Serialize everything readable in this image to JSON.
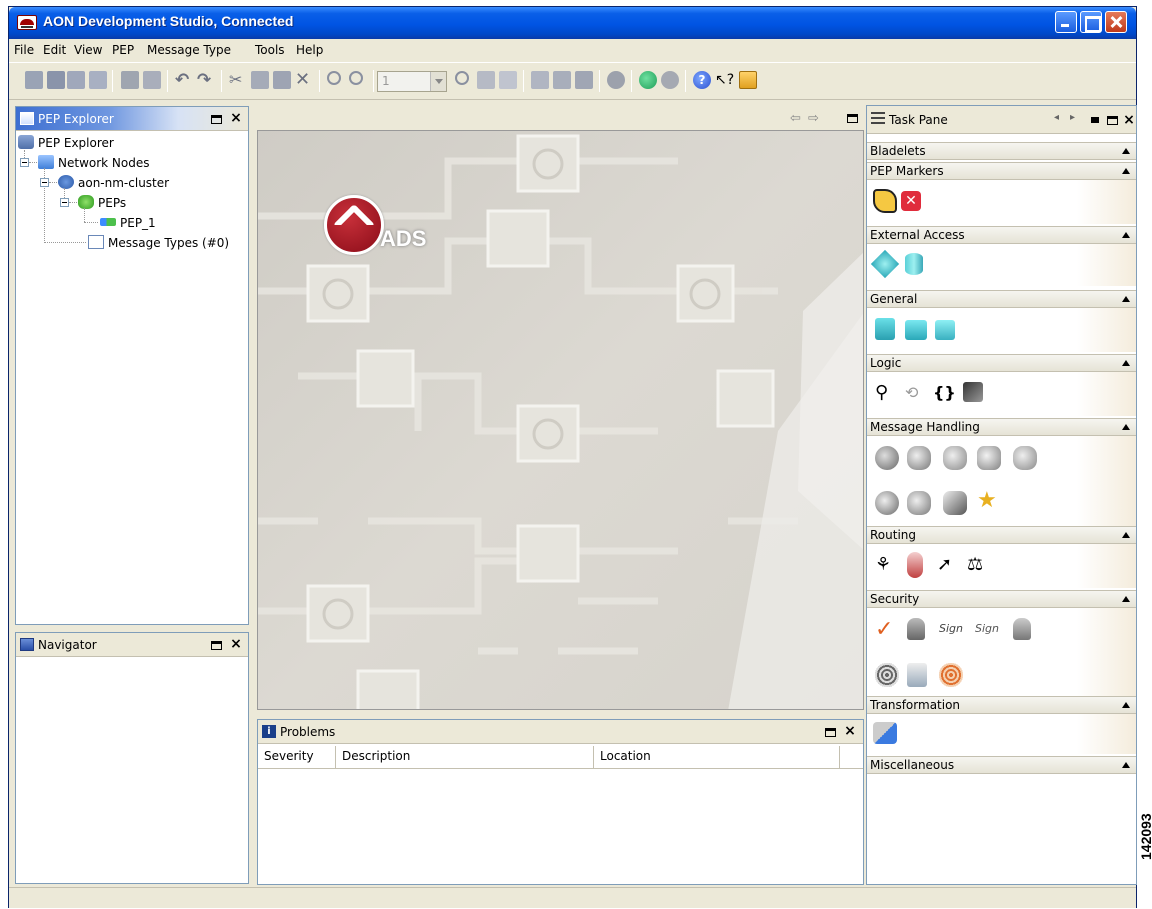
{
  "window": {
    "title": "AON Development Studio, Connected"
  },
  "menu": [
    "File",
    "Edit",
    "View",
    "PEP",
    "Message Type",
    "Tools",
    "Help"
  ],
  "toolbar": {
    "zoom_value": "1"
  },
  "pep_explorer": {
    "title": "PEP Explorer",
    "tree": {
      "root": "PEP Explorer",
      "network_nodes": "Network Nodes",
      "cluster": "aon-nm-cluster",
      "peps": "PEPs",
      "pep1": "PEP_1",
      "message_types": "Message Types (#0)"
    }
  },
  "navigator": {
    "title": "Navigator"
  },
  "editor": {
    "logo_text": "ADS"
  },
  "task_pane": {
    "title": "Task Pane",
    "bladelets": "Bladelets",
    "sections": {
      "pep_markers": "PEP Markers",
      "external_access": "External Access",
      "general": "General",
      "logic": "Logic",
      "message_handling": "Message Handling",
      "routing": "Routing",
      "security": "Security",
      "transformation": "Transformation",
      "miscellaneous": "Miscellaneous"
    }
  },
  "problems": {
    "title": "Problems",
    "columns": {
      "severity": "Severity",
      "description": "Description",
      "location": "Location"
    }
  },
  "figure_id": "142093"
}
